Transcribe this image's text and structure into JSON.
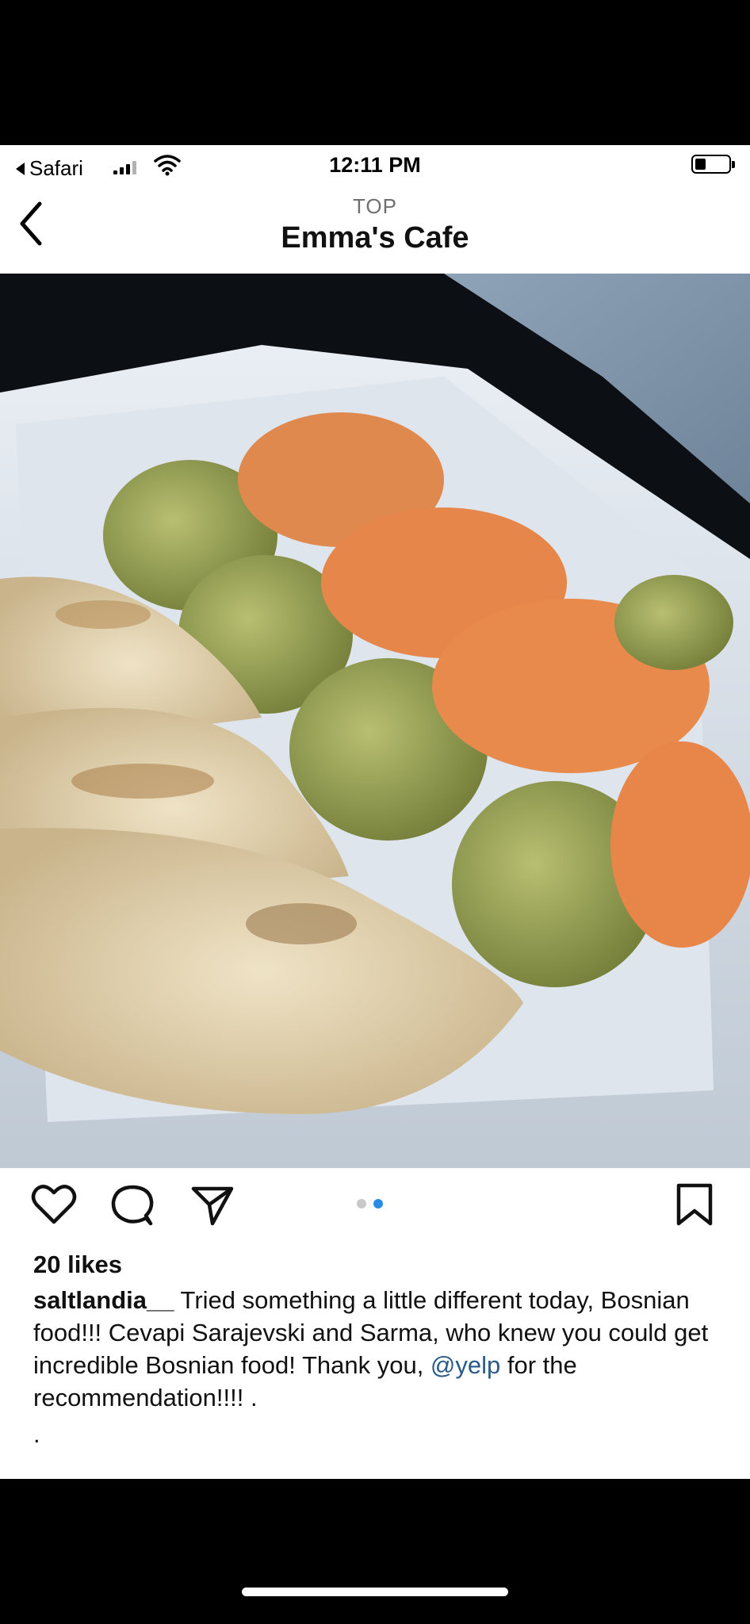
{
  "status_bar": {
    "back_app": "Safari",
    "time": "12:11 PM"
  },
  "nav": {
    "subtitle": "TOP",
    "title": "Emma's Cafe"
  },
  "photo": {
    "description_icon": "photo-of-sarma-and-bread"
  },
  "actions": {
    "like_icon": "heart-icon",
    "comment_icon": "comment-icon",
    "share_icon": "send-icon",
    "save_icon": "bookmark-icon",
    "page_count": 2,
    "active_page": 2
  },
  "post": {
    "likes": "20 likes",
    "username": "saltlandia__",
    "caption_text": " Tried something a little different today, Bosnian food!!! Cevapi Sarajevski and Sarma, who knew you could get incredible Bosnian food! Thank you, ",
    "mention": "@yelp",
    "caption_end": " for the recommendation!!!! .",
    "trailing_dot": "."
  },
  "colors": {
    "mention": "#2a5a8a",
    "dot_active": "#2b8ce6",
    "dot_inactive": "#c9c9c9"
  }
}
